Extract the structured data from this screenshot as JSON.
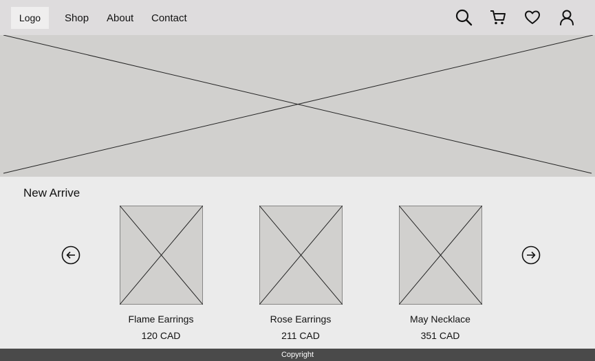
{
  "header": {
    "logo": "Logo",
    "nav": [
      "Shop",
      "About",
      "Contact"
    ],
    "icons": [
      "search-icon",
      "cart-icon",
      "heart-icon",
      "user-icon"
    ]
  },
  "section": {
    "title": "New Arrive",
    "prev_icon": "arrow-left-circle-icon",
    "next_icon": "arrow-right-circle-icon"
  },
  "products": [
    {
      "name": "Flame Earrings",
      "price": "120 CAD"
    },
    {
      "name": "Rose Earrings",
      "price": "211 CAD"
    },
    {
      "name": "May Necklace",
      "price": "351 CAD"
    }
  ],
  "footer": {
    "text": "Copyright"
  },
  "colors": {
    "header_bg": "#dedcdd",
    "placeholder_bg": "#d1d0ce",
    "page_bg": "#ebebeb",
    "footer_bg": "#4a4a4a"
  }
}
